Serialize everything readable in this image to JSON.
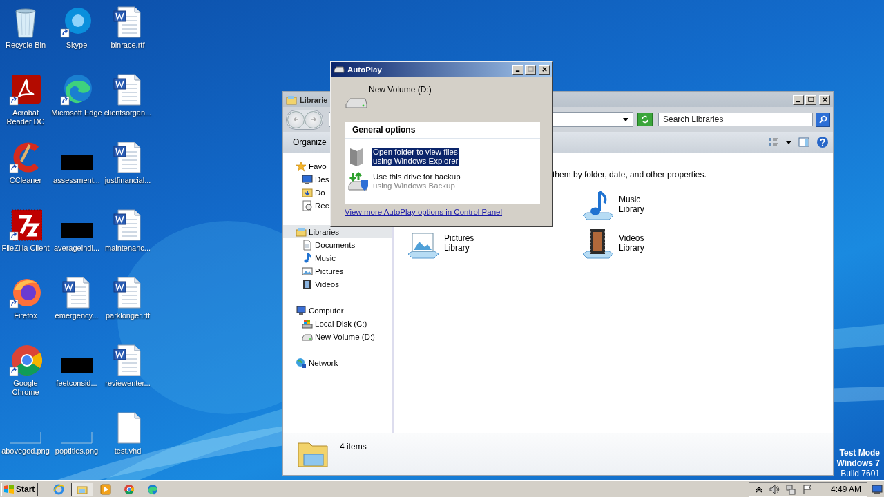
{
  "desktop": {
    "icons": [
      {
        "label": "Recycle Bin",
        "kind": "recycle",
        "shortcut": false
      },
      {
        "label": "Skype",
        "kind": "skype",
        "shortcut": true
      },
      {
        "label": "binrace.rtf",
        "kind": "word",
        "shortcut": false
      },
      {
        "label": "Acrobat\nReader DC",
        "kind": "acrobat",
        "shortcut": true
      },
      {
        "label": "Microsoft Edge",
        "kind": "edge",
        "shortcut": true
      },
      {
        "label": "clientsorgan...",
        "kind": "word",
        "shortcut": false
      },
      {
        "label": "CCleaner",
        "kind": "ccleaner",
        "shortcut": true
      },
      {
        "label": "assessment...",
        "kind": "redacted",
        "shortcut": false
      },
      {
        "label": "justfinancial...",
        "kind": "word",
        "shortcut": false
      },
      {
        "label": "FileZilla Client",
        "kind": "filezilla",
        "shortcut": true
      },
      {
        "label": "averageindi...",
        "kind": "redacted",
        "shortcut": false
      },
      {
        "label": "maintenanc...",
        "kind": "word",
        "shortcut": false
      },
      {
        "label": "Firefox",
        "kind": "firefox",
        "shortcut": true
      },
      {
        "label": "emergency...",
        "kind": "word",
        "shortcut": false
      },
      {
        "label": "parklonger.rtf",
        "kind": "word",
        "shortcut": false
      },
      {
        "label": "Google\nChrome",
        "kind": "chrome",
        "shortcut": true
      },
      {
        "label": "feetconsid...",
        "kind": "redacted",
        "shortcut": false
      },
      {
        "label": "reviewenter...",
        "kind": "word",
        "shortcut": false
      },
      {
        "label": "abovegod.png",
        "kind": "image",
        "shortcut": false
      },
      {
        "label": "poptitles.png",
        "kind": "image",
        "shortcut": false
      },
      {
        "label": "test.vhd",
        "kind": "file",
        "shortcut": false
      }
    ],
    "system_notice": [
      "Test Mode",
      "Windows 7",
      "Build 7601"
    ]
  },
  "explorer": {
    "title": "Librarie",
    "search": {
      "placeholder": "Search Libraries"
    },
    "toolbar": {
      "organize": "Organize"
    },
    "nav": [
      {
        "label": "Favo",
        "kind": "star",
        "selected": false,
        "children": [
          {
            "label": "Des",
            "kind": "desktop",
            "selected": false
          },
          {
            "label": "Do",
            "kind": "downloads",
            "selected": false
          },
          {
            "label": "Rec",
            "kind": "recent",
            "selected": false
          }
        ]
      },
      {
        "label": "Libraries",
        "kind": "library",
        "selected": true,
        "children": [
          {
            "label": "Documents",
            "kind": "document",
            "selected": false
          },
          {
            "label": "Music",
            "kind": "music",
            "selected": false
          },
          {
            "label": "Pictures",
            "kind": "picture",
            "selected": false
          },
          {
            "label": "Videos",
            "kind": "video",
            "selected": false
          }
        ]
      },
      {
        "label": "Computer",
        "kind": "computer",
        "selected": false,
        "children": [
          {
            "label": "Local Disk (C:)",
            "kind": "disk",
            "selected": false
          },
          {
            "label": "New Volume (D:)",
            "kind": "drive",
            "selected": false
          }
        ]
      },
      {
        "label": "Network",
        "kind": "network",
        "selected": false
      }
    ],
    "header_text": "them by folder, date, and other properties.",
    "libraries": [
      {
        "name": "Music",
        "sub": "Library",
        "kind": "music"
      },
      {
        "name": "Pictures",
        "sub": "Library",
        "kind": "picture"
      },
      {
        "name": "Videos",
        "sub": "Library",
        "kind": "video"
      }
    ],
    "status": "4 items"
  },
  "autoplay": {
    "title": "AutoPlay",
    "device": "New Volume (D:)",
    "section": "General options",
    "options": [
      {
        "title": "Open folder to view files",
        "subtitle": "using Windows Explorer",
        "kind": "folder",
        "selected": true
      },
      {
        "title": "Use this drive for backup",
        "subtitle": "using Windows Backup",
        "kind": "backup",
        "selected": false
      }
    ],
    "link": "View more AutoPlay options in Control Panel"
  },
  "taskbar": {
    "start": "Start",
    "apps": [
      {
        "kind": "ie",
        "selected": false
      },
      {
        "kind": "explorer",
        "selected": true
      },
      {
        "kind": "media",
        "selected": false
      },
      {
        "kind": "chrome",
        "selected": false
      },
      {
        "kind": "edge",
        "selected": false
      }
    ],
    "time": "4:49 AM"
  }
}
